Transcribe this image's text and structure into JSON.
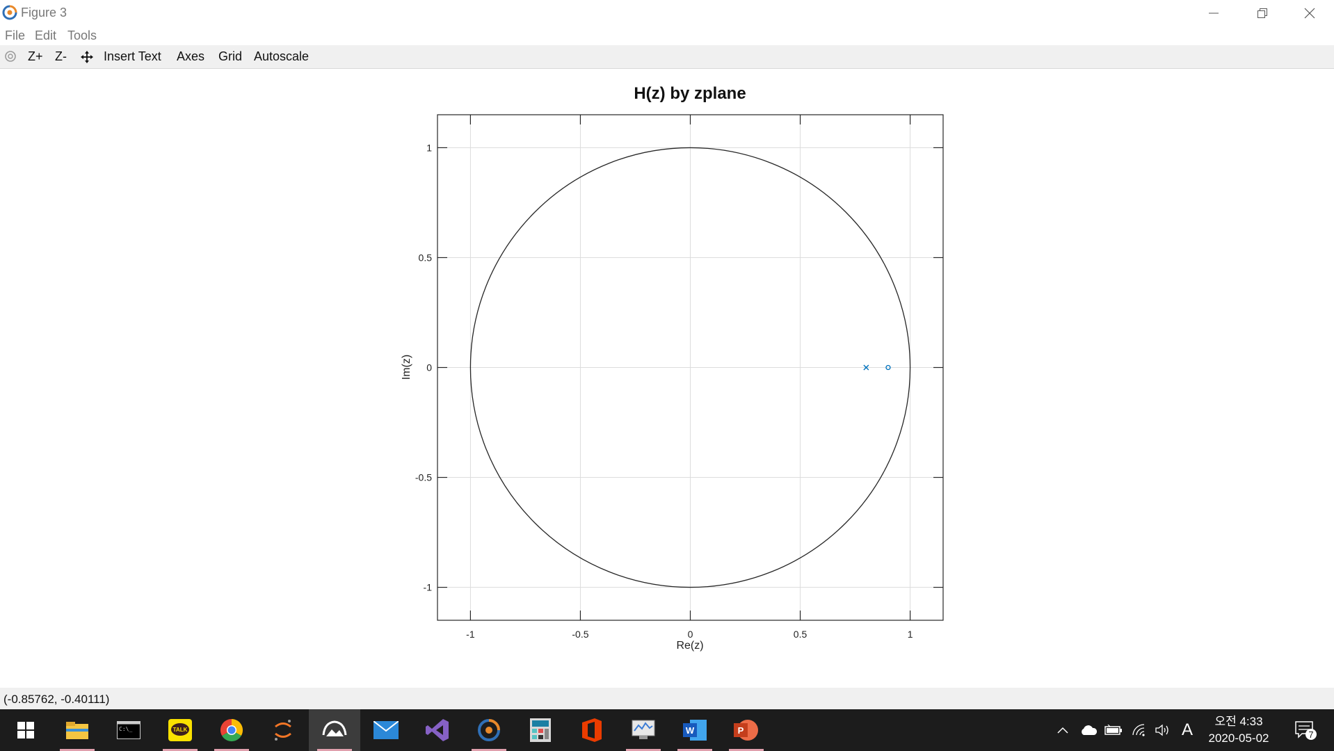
{
  "window": {
    "title": "Figure 3",
    "controls": [
      "minimize",
      "restore",
      "close"
    ]
  },
  "menu": {
    "items": [
      "File",
      "Edit",
      "Tools"
    ]
  },
  "toolbar": {
    "zoom_in": "Z+",
    "zoom_out": "Z-",
    "insert_text": "Insert Text",
    "axes": "Axes",
    "grid": "Grid",
    "autoscale": "Autoscale"
  },
  "plot": {
    "title": "H(z) by zplane",
    "xlabel": "Re(z)",
    "ylabel": "Im(z)"
  },
  "chart_data": {
    "type": "scatter",
    "title": "H(z) by zplane",
    "xlabel": "Re(z)",
    "ylabel": "Im(z)",
    "xlim": [
      -1.15,
      1.15
    ],
    "ylim": [
      -1.15,
      1.15
    ],
    "xticks": [
      "-1",
      "-0.5",
      "0",
      "0.5",
      "1"
    ],
    "yticks": [
      "1",
      "0.5",
      "0",
      "-0.5",
      "-1"
    ],
    "grid": true,
    "unit_circle": true,
    "poles": [
      [
        0.8,
        0
      ]
    ],
    "zeros": [
      [
        0.9,
        0
      ]
    ],
    "marker_color": "#0072bd",
    "circle_color": "#262626"
  },
  "status": {
    "coords": "(-0.85762, -0.40111)"
  },
  "taskbar": {
    "apps": [
      "start-icon",
      "file-explorer-icon",
      "terminal-icon",
      "kakaotalk-icon",
      "chrome-icon",
      "jupyter-icon",
      "photos-icon",
      "mail-icon",
      "visual-studio-icon",
      "octave-icon",
      "calculator-icon",
      "office-icon",
      "monitor-icon",
      "word-icon",
      "powerpoint-icon"
    ],
    "time": "오전 4:33",
    "date": "2020-05-02",
    "ime": "A",
    "notifications": "7"
  },
  "colors": {
    "accent": "#0072bd",
    "taskbar": "#1c1c1c",
    "toolbar": "#f0f0f0"
  }
}
